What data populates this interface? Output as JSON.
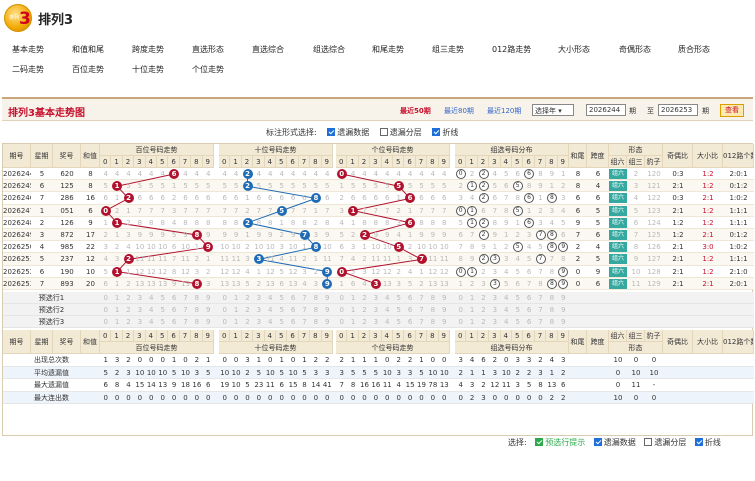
{
  "app": {
    "logo_text": "排列",
    "logo_num": "3",
    "title": "排列3"
  },
  "nav": {
    "row1": [
      "基本走势",
      "和值和尾",
      "跨度走势",
      "直选形态",
      "直选综合",
      "组选综合",
      "和尾走势",
      "组三走势",
      "012路走势",
      "大小形态",
      "奇偶形态",
      "质合形态"
    ],
    "row2": [
      "二码走势",
      "百位走势",
      "十位走势",
      "个位走势"
    ]
  },
  "toolbar": {
    "title": "排列3基本走势图",
    "links": [
      "最近50期",
      "最近80期",
      "最近120期"
    ],
    "select_value": "选择年",
    "from_value": "2026244",
    "from_suffix": "期",
    "to_label": "至",
    "to_value": "2026253",
    "to_suffix": "期",
    "query_label": "查看"
  },
  "options": {
    "label": "标注形式选择:",
    "items": [
      "遗漏数据",
      "遗漏分层",
      "折线"
    ],
    "checked": [
      true,
      false,
      true
    ]
  },
  "table": {
    "head_top": [
      "期号",
      "星期",
      "奖号",
      "和值",
      "百位号码走势",
      "十位号码走势",
      "个位号码走势",
      "组选号码分布",
      "和尾",
      "跨度",
      "形态",
      "奇偶比",
      "大小比",
      "012路个数比"
    ],
    "shape_sub": [
      "组六",
      "组三",
      "豹子"
    ],
    "digits": [
      "0",
      "1",
      "2",
      "3",
      "4",
      "5",
      "6",
      "7",
      "8",
      "9"
    ],
    "rows": [
      {
        "issue": "2026244",
        "week": "5",
        "num": "620",
        "sum": "8",
        "b": 6,
        "s": 2,
        "g": 0,
        "tail": "8",
        "span": "6",
        "ratio_oe": "0:3",
        "ratio_bs": "1:2",
        "ratio_012": "2:0:1",
        "gs": "0,2,6"
      },
      {
        "issue": "2026245",
        "week": "6",
        "num": "125",
        "sum": "8",
        "b": 1,
        "s": 2,
        "g": 5,
        "tail": "8",
        "span": "4",
        "ratio_oe": "2:1",
        "ratio_bs": "1:2",
        "ratio_012": "0:1:2",
        "gs": "1,2,5"
      },
      {
        "issue": "2026246",
        "week": "7",
        "num": "286",
        "sum": "16",
        "b": 2,
        "s": 8,
        "g": 6,
        "tail": "6",
        "span": "6",
        "ratio_oe": "0:3",
        "ratio_bs": "2:1",
        "ratio_012": "1:0:2",
        "gs": "2,6,8"
      },
      {
        "issue": "2026247",
        "week": "1",
        "num": "051",
        "sum": "6",
        "b": 0,
        "s": 5,
        "g": 1,
        "tail": "6",
        "span": "5",
        "ratio_oe": "2:1",
        "ratio_bs": "1:2",
        "ratio_012": "1:1:1",
        "gs": "0,1,5"
      },
      {
        "issue": "2026248",
        "week": "2",
        "num": "126",
        "sum": "9",
        "b": 1,
        "s": 2,
        "g": 6,
        "tail": "9",
        "span": "5",
        "ratio_oe": "1:2",
        "ratio_bs": "1:2",
        "ratio_012": "1:1:1",
        "gs": "1,2,6"
      },
      {
        "issue": "2026249",
        "week": "3",
        "num": "872",
        "sum": "17",
        "b": 8,
        "s": 7,
        "g": 2,
        "tail": "7",
        "span": "6",
        "ratio_oe": "1:2",
        "ratio_bs": "2:1",
        "ratio_012": "0:1:2",
        "gs": "2,7,8"
      },
      {
        "issue": "2026250",
        "week": "4",
        "num": "985",
        "sum": "22",
        "b": 9,
        "s": 8,
        "g": 5,
        "tail": "2",
        "span": "4",
        "ratio_oe": "2:1",
        "ratio_bs": "3:0",
        "ratio_012": "1:0:2",
        "gs": "5,8,9"
      },
      {
        "issue": "2026251",
        "week": "5",
        "num": "237",
        "sum": "12",
        "b": 2,
        "s": 3,
        "g": 7,
        "tail": "2",
        "span": "5",
        "ratio_oe": "2:1",
        "ratio_bs": "1:2",
        "ratio_012": "1:1:1",
        "gs": "2,3,7"
      },
      {
        "issue": "2026252",
        "week": "6",
        "num": "190",
        "sum": "10",
        "b": 1,
        "s": 9,
        "g": 0,
        "tail": "0",
        "span": "9",
        "ratio_oe": "2:1",
        "ratio_bs": "1:2",
        "ratio_012": "2:1:0",
        "gs": "0,1,9"
      },
      {
        "issue": "2026253",
        "week": "7",
        "num": "893",
        "sum": "20",
        "b": 8,
        "s": 9,
        "g": 3,
        "tail": "0",
        "span": "6",
        "ratio_oe": "2:1",
        "ratio_bs": "2:1",
        "ratio_012": "2:0:1",
        "gs": "3,8,9"
      }
    ],
    "pre_rows": [
      "预选行1",
      "预选行2",
      "预选行3"
    ],
    "stat_rows": [
      {
        "label": "出现总次数",
        "b": "1 3 2 0 0 0 1 0 2 1",
        "s": "0 0 3 1 0 1 0 1 2 2",
        "g": "2 1 1 1 0 2 2 1 0 0",
        "gs": "3 4 6 2 0 3 3 2 4 3",
        "shape": [
          "10",
          "0",
          "0"
        ]
      },
      {
        "label": "平均遗漏值",
        "b": "5 2 3 10 10 10 5 10 3 5",
        "s": "10 10 2 5 10 5 10 5 3 3",
        "g": "3 5 5 5 10 3 3 5 10 10",
        "gs": "2 1 1 3 10 2 2 3 1 2",
        "shape": [
          "0",
          "10",
          "10"
        ]
      },
      {
        "label": "最大遗漏值",
        "b": "6 8 4 15 14 13 9 18 16 6",
        "s": "19 10 5 23 11 6 15 8 14 41",
        "g": "7 8 16 16 11 4 15 19 78 13",
        "gs": "4 3 2 12 11 3 5 8 13 6",
        "shape": [
          "0",
          "11",
          "-"
        ]
      },
      {
        "label": "最大连出数",
        "b": "0 0 0 0 0 0 0 0 0 0",
        "s": "0 0 0 0 0 0 0 0 0 0",
        "g": "0 0 0 0 0 0 0 0 0 0",
        "gs": "0 2 3 0 0 0 0 0 2 2",
        "shape": [
          "10",
          "0",
          "0"
        ]
      }
    ],
    "shape_tag": "组六"
  },
  "footer": {
    "label": "选择:",
    "items": [
      "预选行提示",
      "遗漏数据",
      "遗漏分层",
      "折线"
    ],
    "checked": [
      true,
      true,
      false,
      true
    ]
  },
  "colors": {
    "red": "#b0122e",
    "blue": "#1f6bb5",
    "teal": "#35a89f",
    "accent": "#c8102e"
  }
}
